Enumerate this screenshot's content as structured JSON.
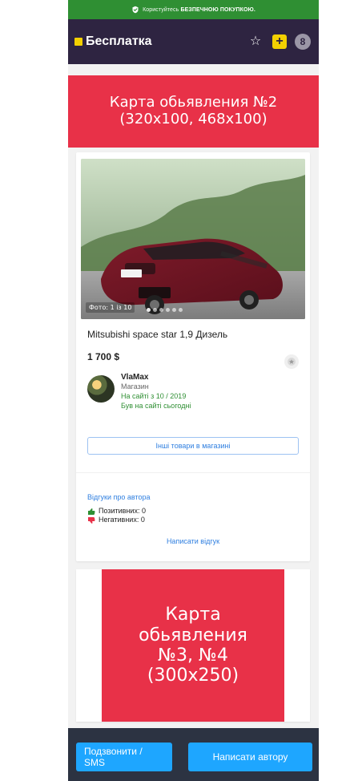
{
  "top_bar": {
    "safe_text_prefix": "Користуйтесь",
    "safe_text_bold": "БЕЗПЕЧНОЮ ПОКУПКОЮ."
  },
  "header": {
    "brand": "Бесплатка",
    "icons": {
      "favorite": "star-icon",
      "add": "plus-icon",
      "account": "user-icon"
    }
  },
  "ads": {
    "top": "Карта обьявления №2\n(320x100, 468x100)",
    "middle": "Карта\nобьявления\n№3, №4\n(300x250)"
  },
  "listing": {
    "photo_counter": "Фото: 1 із 10",
    "title": "Mitsubishi space star 1,9 Дизель",
    "price": "1 700 $",
    "seller": {
      "name": "VlaMax",
      "type": "Магазин",
      "on_site_since": "На сайті з 10 / 2019",
      "last_seen": "Був на сайті сьогодні"
    },
    "shop_button": "Інші товари в магазині",
    "reviews": {
      "title": "Відгуки про автора",
      "positive": "Позитивних: 0",
      "negative": "Негативних: 0",
      "write_review": "Написати відгук"
    }
  },
  "bottom_actions": {
    "call_sms": "Подзвонити / SMS",
    "write_author": "Написати автору"
  },
  "colors": {
    "header_bg": "#2e2441",
    "green": "#2f8f33",
    "ad_red": "#e83148",
    "link_blue": "#2f7fe0",
    "cta_blue": "#1ea6ff"
  }
}
